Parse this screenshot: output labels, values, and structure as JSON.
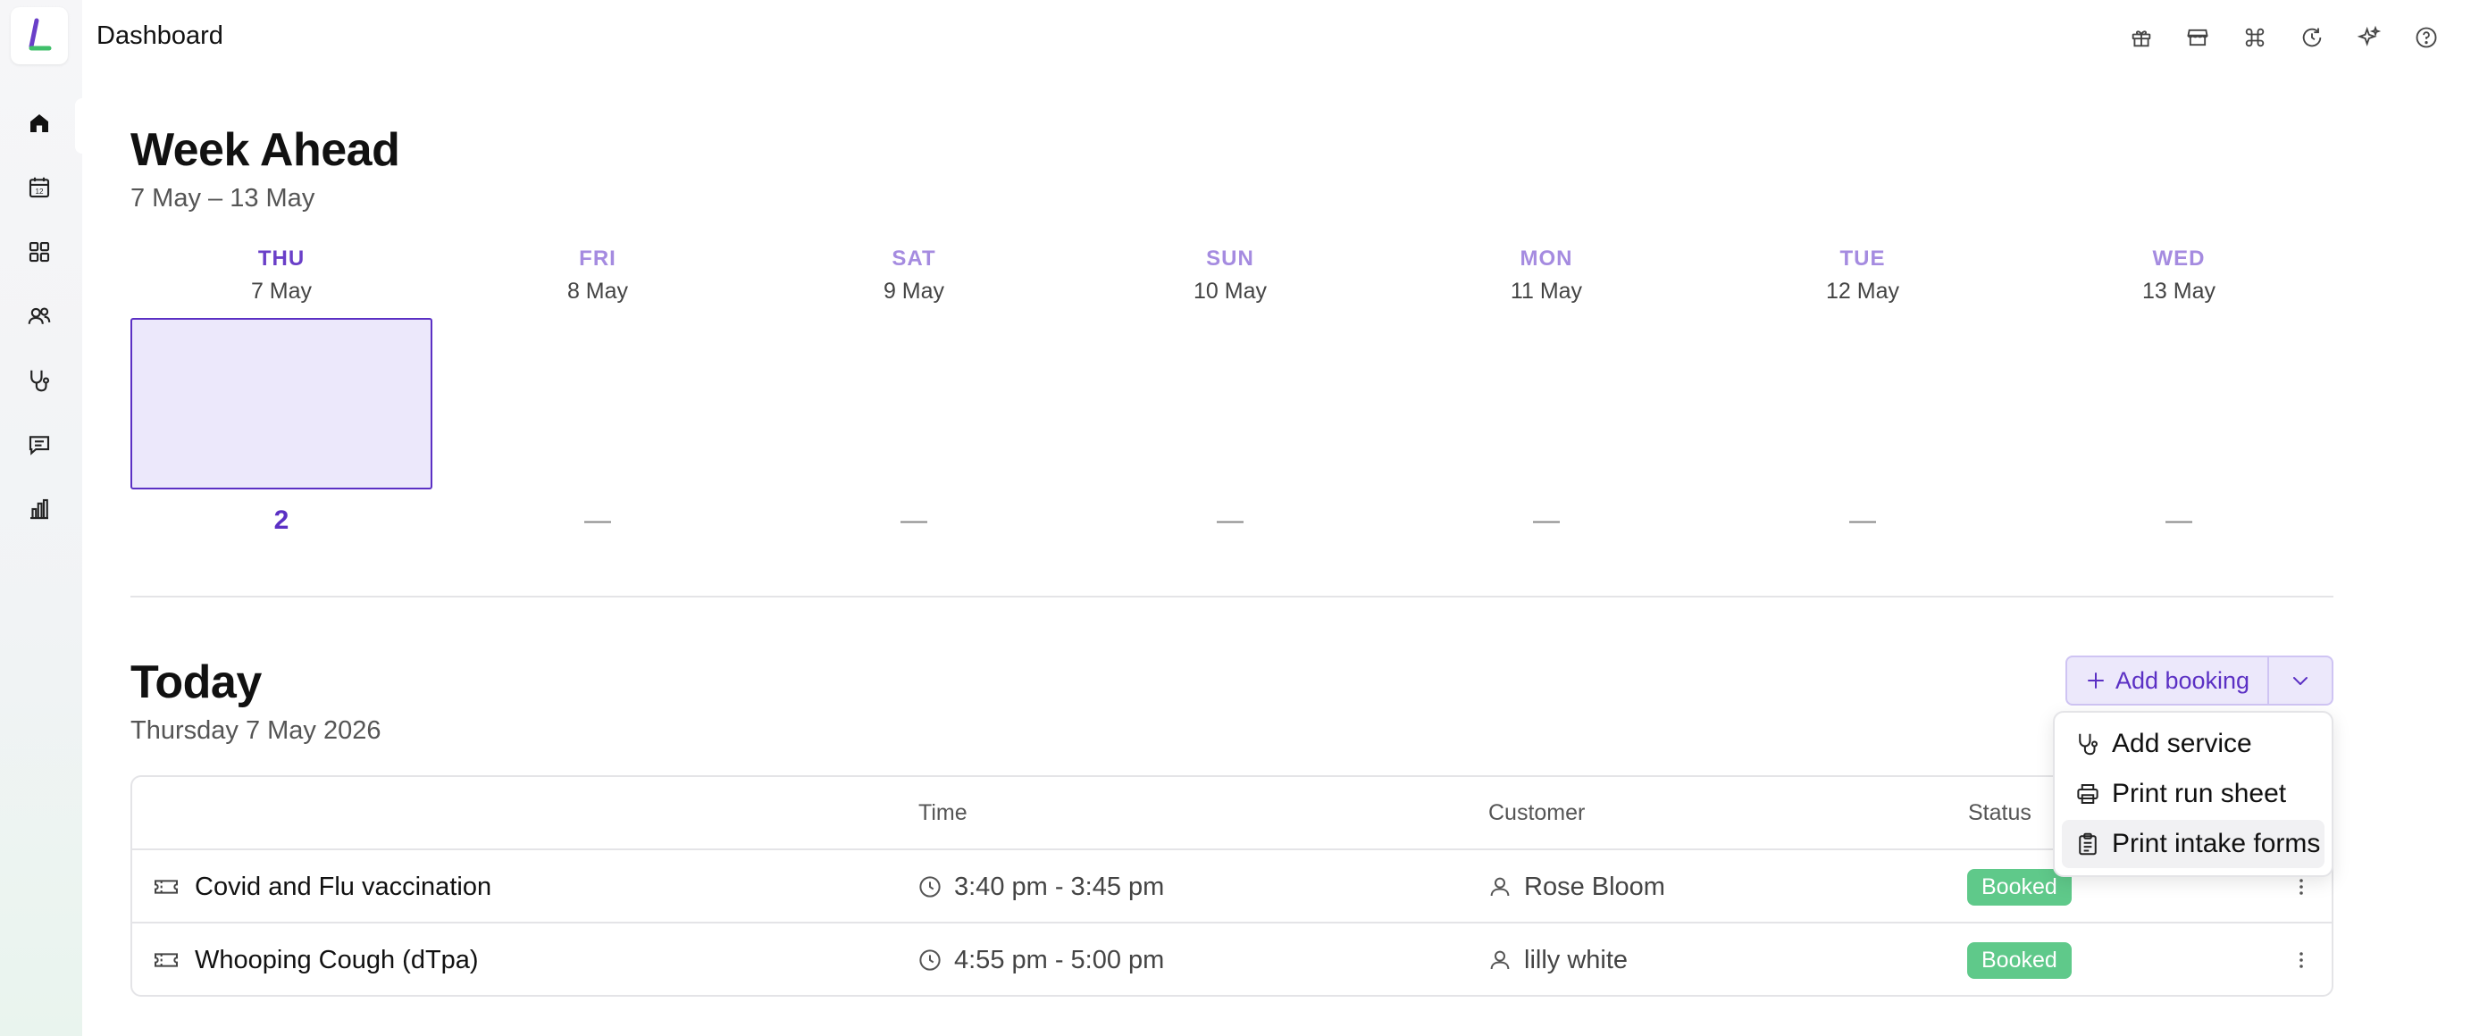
{
  "header": {
    "title": "Dashboard",
    "icons": [
      "gift-icon",
      "store-icon",
      "command-icon",
      "history-icon",
      "sparkle-icon",
      "help-icon"
    ]
  },
  "sidebar": {
    "items": [
      {
        "name": "home",
        "icon": "home-icon",
        "active": true
      },
      {
        "name": "calendar",
        "icon": "calendar-icon"
      },
      {
        "name": "apps",
        "icon": "grid-icon"
      },
      {
        "name": "customers",
        "icon": "users-icon"
      },
      {
        "name": "services",
        "icon": "stethoscope-icon"
      },
      {
        "name": "messages",
        "icon": "message-icon"
      },
      {
        "name": "reports",
        "icon": "chart-icon"
      }
    ]
  },
  "week_ahead": {
    "title": "Week Ahead",
    "range": "7 May – 13 May",
    "days": [
      {
        "name": "THU",
        "date": "7 May",
        "count": "2"
      },
      {
        "name": "FRI",
        "date": "8 May",
        "count": "—"
      },
      {
        "name": "SAT",
        "date": "9 May",
        "count": "—"
      },
      {
        "name": "SUN",
        "date": "10 May",
        "count": "—"
      },
      {
        "name": "MON",
        "date": "11 May",
        "count": "—"
      },
      {
        "name": "TUE",
        "date": "12 May",
        "count": "—"
      },
      {
        "name": "WED",
        "date": "13 May",
        "count": "—"
      }
    ]
  },
  "today": {
    "title": "Today",
    "date": "Thursday 7 May 2026",
    "add_booking_label": "Add booking",
    "menu": [
      {
        "label": "Add service",
        "icon": "stethoscope-icon"
      },
      {
        "label": "Print run sheet",
        "icon": "printer-icon"
      },
      {
        "label": "Print intake forms",
        "icon": "clipboard-icon"
      }
    ],
    "columns": {
      "time": "Time",
      "customer": "Customer",
      "status": "Status"
    },
    "rows": [
      {
        "service": "Covid and Flu vaccination",
        "time": "3:40 pm - 3:45 pm",
        "customer": "Rose Bloom",
        "status": "Booked"
      },
      {
        "service": "Whooping Cough (dTpa)",
        "time": "4:55 pm - 5:00 pm",
        "customer": "lilly white",
        "status": "Booked"
      }
    ]
  },
  "colors": {
    "accent": "#5b30c4",
    "accent_light": "#ece8fb",
    "booked": "#5fc98a"
  }
}
